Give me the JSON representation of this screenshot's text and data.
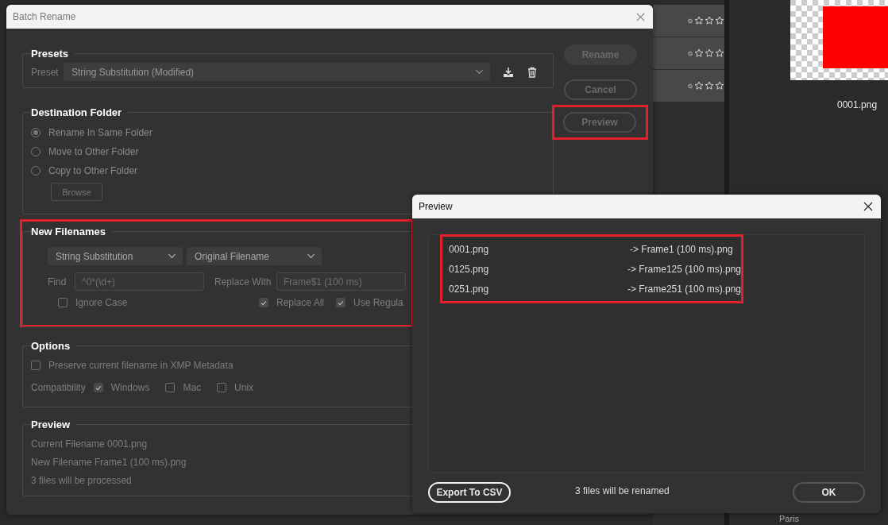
{
  "background": {
    "rows": [
      {
        "stars": 0
      },
      {
        "stars": 0
      },
      {
        "stars": 0
      }
    ],
    "thumbnail_caption": "0001.png",
    "folder": "Paris"
  },
  "batch_rename": {
    "title": "Batch Rename",
    "presets": {
      "legend": "Presets",
      "label": "Preset",
      "value": "String Substitution (Modified)"
    },
    "destination": {
      "legend": "Destination Folder",
      "options": [
        {
          "label": "Rename In Same Folder",
          "selected": true
        },
        {
          "label": "Move to Other Folder",
          "selected": false
        },
        {
          "label": "Copy to Other Folder",
          "selected": false
        }
      ],
      "browse": "Browse"
    },
    "new_filenames": {
      "legend": "New Filenames",
      "highlighted": true,
      "type": "String Substitution",
      "source": "Original Filename",
      "find_label": "Find",
      "find": "^0*(\\d+)",
      "replace_label": "Replace With",
      "replace": "Frame$1 (100 ms)",
      "checks": [
        {
          "label": "Ignore Case",
          "checked": false
        },
        {
          "label": "Replace All",
          "checked": true
        },
        {
          "label": "Use Regula",
          "checked": true
        }
      ]
    },
    "options": {
      "legend": "Options",
      "preserve": {
        "label": "Preserve current filename in XMP Metadata",
        "checked": false
      },
      "compat_label": "Compatibility",
      "compat": [
        {
          "label": "Windows",
          "checked": true
        },
        {
          "label": "Mac",
          "checked": false
        },
        {
          "label": "Unix",
          "checked": false
        }
      ]
    },
    "preview": {
      "legend": "Preview",
      "lines": [
        "Current Filename 0001.png",
        "New Filename Frame1 (100 ms).png",
        "3 files will be processed"
      ]
    },
    "buttons": [
      {
        "label": "Rename",
        "kind": "filled",
        "highlighted": false
      },
      {
        "label": "Cancel",
        "kind": "outline",
        "highlighted": false
      },
      {
        "label": "Preview",
        "kind": "outline",
        "highlighted": true
      }
    ]
  },
  "preview_dialog": {
    "title": "Preview",
    "highlighted": true,
    "rows": [
      {
        "from": "0001.png",
        "to": "-> Frame1 (100 ms).png"
      },
      {
        "from": "0125.png",
        "to": "-> Frame125 (100 ms).png"
      },
      {
        "from": "0251.png",
        "to": "-> Frame251 (100 ms).png"
      }
    ],
    "export": "Export To CSV",
    "summary": "3 files will be renamed",
    "ok": "OK"
  }
}
